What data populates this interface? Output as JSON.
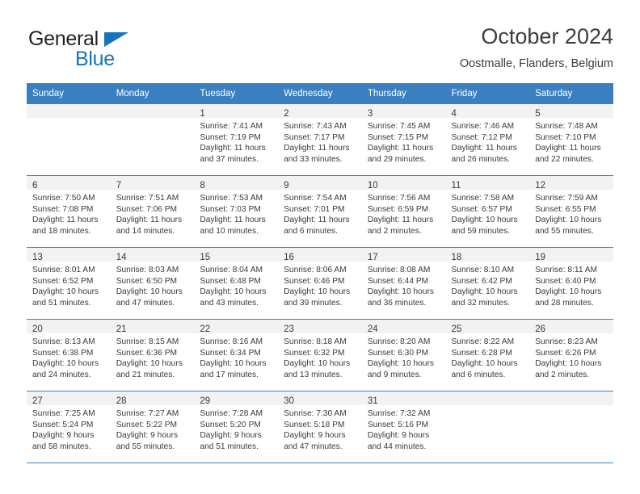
{
  "brand": {
    "line1": "General",
    "line2": "Blue",
    "triangle_color": "#1574bb",
    "text_color": "#231f20"
  },
  "header": {
    "title": "October 2024",
    "subtitle": "Oostmalle, Flanders, Belgium"
  },
  "colors": {
    "header_blue": "#3a80c1",
    "daynum_band": "#f2f2f2",
    "text": "#3a3a3a"
  },
  "weekday_headers": [
    "Sunday",
    "Monday",
    "Tuesday",
    "Wednesday",
    "Thursday",
    "Friday",
    "Saturday"
  ],
  "weeks": [
    [
      {
        "day": "",
        "sunrise": "",
        "sunset": "",
        "daylight_line1": "",
        "daylight_line2": ""
      },
      {
        "day": "",
        "sunrise": "",
        "sunset": "",
        "daylight_line1": "",
        "daylight_line2": ""
      },
      {
        "day": "1",
        "sunrise": "Sunrise: 7:41 AM",
        "sunset": "Sunset: 7:19 PM",
        "daylight_line1": "Daylight: 11 hours",
        "daylight_line2": "and 37 minutes."
      },
      {
        "day": "2",
        "sunrise": "Sunrise: 7:43 AM",
        "sunset": "Sunset: 7:17 PM",
        "daylight_line1": "Daylight: 11 hours",
        "daylight_line2": "and 33 minutes."
      },
      {
        "day": "3",
        "sunrise": "Sunrise: 7:45 AM",
        "sunset": "Sunset: 7:15 PM",
        "daylight_line1": "Daylight: 11 hours",
        "daylight_line2": "and 29 minutes."
      },
      {
        "day": "4",
        "sunrise": "Sunrise: 7:46 AM",
        "sunset": "Sunset: 7:12 PM",
        "daylight_line1": "Daylight: 11 hours",
        "daylight_line2": "and 26 minutes."
      },
      {
        "day": "5",
        "sunrise": "Sunrise: 7:48 AM",
        "sunset": "Sunset: 7:10 PM",
        "daylight_line1": "Daylight: 11 hours",
        "daylight_line2": "and 22 minutes."
      }
    ],
    [
      {
        "day": "6",
        "sunrise": "Sunrise: 7:50 AM",
        "sunset": "Sunset: 7:08 PM",
        "daylight_line1": "Daylight: 11 hours",
        "daylight_line2": "and 18 minutes."
      },
      {
        "day": "7",
        "sunrise": "Sunrise: 7:51 AM",
        "sunset": "Sunset: 7:06 PM",
        "daylight_line1": "Daylight: 11 hours",
        "daylight_line2": "and 14 minutes."
      },
      {
        "day": "8",
        "sunrise": "Sunrise: 7:53 AM",
        "sunset": "Sunset: 7:03 PM",
        "daylight_line1": "Daylight: 11 hours",
        "daylight_line2": "and 10 minutes."
      },
      {
        "day": "9",
        "sunrise": "Sunrise: 7:54 AM",
        "sunset": "Sunset: 7:01 PM",
        "daylight_line1": "Daylight: 11 hours",
        "daylight_line2": "and 6 minutes."
      },
      {
        "day": "10",
        "sunrise": "Sunrise: 7:56 AM",
        "sunset": "Sunset: 6:59 PM",
        "daylight_line1": "Daylight: 11 hours",
        "daylight_line2": "and 2 minutes."
      },
      {
        "day": "11",
        "sunrise": "Sunrise: 7:58 AM",
        "sunset": "Sunset: 6:57 PM",
        "daylight_line1": "Daylight: 10 hours",
        "daylight_line2": "and 59 minutes."
      },
      {
        "day": "12",
        "sunrise": "Sunrise: 7:59 AM",
        "sunset": "Sunset: 6:55 PM",
        "daylight_line1": "Daylight: 10 hours",
        "daylight_line2": "and 55 minutes."
      }
    ],
    [
      {
        "day": "13",
        "sunrise": "Sunrise: 8:01 AM",
        "sunset": "Sunset: 6:52 PM",
        "daylight_line1": "Daylight: 10 hours",
        "daylight_line2": "and 51 minutes."
      },
      {
        "day": "14",
        "sunrise": "Sunrise: 8:03 AM",
        "sunset": "Sunset: 6:50 PM",
        "daylight_line1": "Daylight: 10 hours",
        "daylight_line2": "and 47 minutes."
      },
      {
        "day": "15",
        "sunrise": "Sunrise: 8:04 AM",
        "sunset": "Sunset: 6:48 PM",
        "daylight_line1": "Daylight: 10 hours",
        "daylight_line2": "and 43 minutes."
      },
      {
        "day": "16",
        "sunrise": "Sunrise: 8:06 AM",
        "sunset": "Sunset: 6:46 PM",
        "daylight_line1": "Daylight: 10 hours",
        "daylight_line2": "and 39 minutes."
      },
      {
        "day": "17",
        "sunrise": "Sunrise: 8:08 AM",
        "sunset": "Sunset: 6:44 PM",
        "daylight_line1": "Daylight: 10 hours",
        "daylight_line2": "and 36 minutes."
      },
      {
        "day": "18",
        "sunrise": "Sunrise: 8:10 AM",
        "sunset": "Sunset: 6:42 PM",
        "daylight_line1": "Daylight: 10 hours",
        "daylight_line2": "and 32 minutes."
      },
      {
        "day": "19",
        "sunrise": "Sunrise: 8:11 AM",
        "sunset": "Sunset: 6:40 PM",
        "daylight_line1": "Daylight: 10 hours",
        "daylight_line2": "and 28 minutes."
      }
    ],
    [
      {
        "day": "20",
        "sunrise": "Sunrise: 8:13 AM",
        "sunset": "Sunset: 6:38 PM",
        "daylight_line1": "Daylight: 10 hours",
        "daylight_line2": "and 24 minutes."
      },
      {
        "day": "21",
        "sunrise": "Sunrise: 8:15 AM",
        "sunset": "Sunset: 6:36 PM",
        "daylight_line1": "Daylight: 10 hours",
        "daylight_line2": "and 21 minutes."
      },
      {
        "day": "22",
        "sunrise": "Sunrise: 8:16 AM",
        "sunset": "Sunset: 6:34 PM",
        "daylight_line1": "Daylight: 10 hours",
        "daylight_line2": "and 17 minutes."
      },
      {
        "day": "23",
        "sunrise": "Sunrise: 8:18 AM",
        "sunset": "Sunset: 6:32 PM",
        "daylight_line1": "Daylight: 10 hours",
        "daylight_line2": "and 13 minutes."
      },
      {
        "day": "24",
        "sunrise": "Sunrise: 8:20 AM",
        "sunset": "Sunset: 6:30 PM",
        "daylight_line1": "Daylight: 10 hours",
        "daylight_line2": "and 9 minutes."
      },
      {
        "day": "25",
        "sunrise": "Sunrise: 8:22 AM",
        "sunset": "Sunset: 6:28 PM",
        "daylight_line1": "Daylight: 10 hours",
        "daylight_line2": "and 6 minutes."
      },
      {
        "day": "26",
        "sunrise": "Sunrise: 8:23 AM",
        "sunset": "Sunset: 6:26 PM",
        "daylight_line1": "Daylight: 10 hours",
        "daylight_line2": "and 2 minutes."
      }
    ],
    [
      {
        "day": "27",
        "sunrise": "Sunrise: 7:25 AM",
        "sunset": "Sunset: 5:24 PM",
        "daylight_line1": "Daylight: 9 hours",
        "daylight_line2": "and 58 minutes."
      },
      {
        "day": "28",
        "sunrise": "Sunrise: 7:27 AM",
        "sunset": "Sunset: 5:22 PM",
        "daylight_line1": "Daylight: 9 hours",
        "daylight_line2": "and 55 minutes."
      },
      {
        "day": "29",
        "sunrise": "Sunrise: 7:28 AM",
        "sunset": "Sunset: 5:20 PM",
        "daylight_line1": "Daylight: 9 hours",
        "daylight_line2": "and 51 minutes."
      },
      {
        "day": "30",
        "sunrise": "Sunrise: 7:30 AM",
        "sunset": "Sunset: 5:18 PM",
        "daylight_line1": "Daylight: 9 hours",
        "daylight_line2": "and 47 minutes."
      },
      {
        "day": "31",
        "sunrise": "Sunrise: 7:32 AM",
        "sunset": "Sunset: 5:16 PM",
        "daylight_line1": "Daylight: 9 hours",
        "daylight_line2": "and 44 minutes."
      },
      {
        "day": "",
        "sunrise": "",
        "sunset": "",
        "daylight_line1": "",
        "daylight_line2": ""
      },
      {
        "day": "",
        "sunrise": "",
        "sunset": "",
        "daylight_line1": "",
        "daylight_line2": ""
      }
    ]
  ]
}
